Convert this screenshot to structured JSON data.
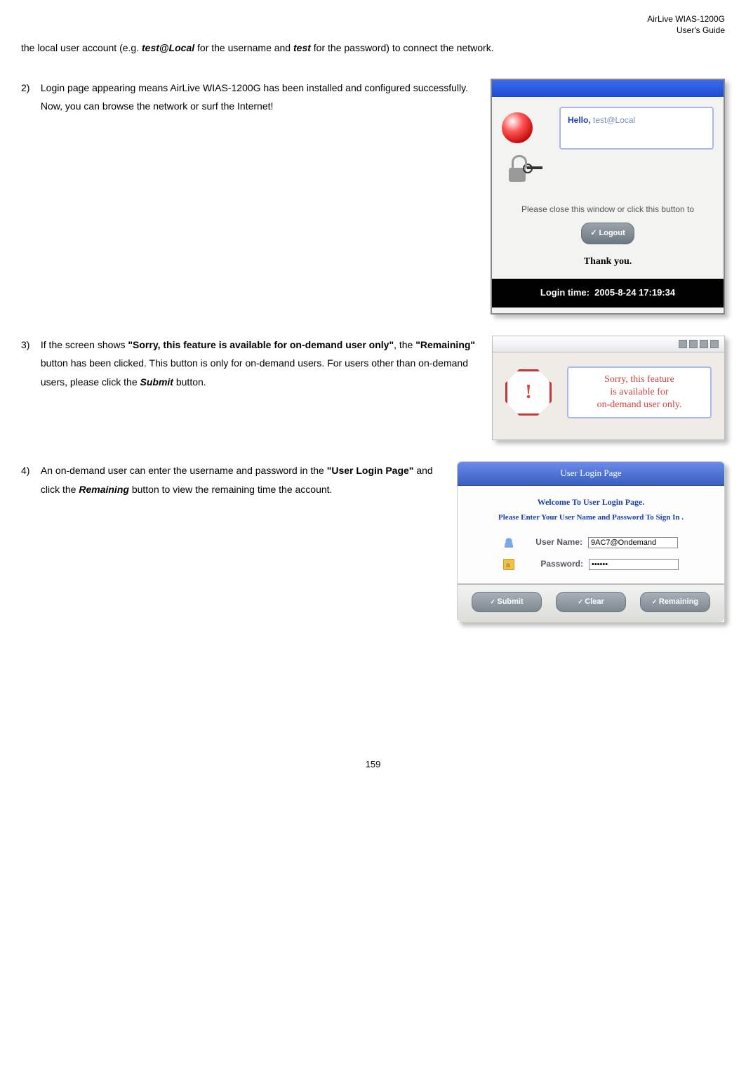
{
  "header": {
    "line1": "AirLive WIAS-1200G",
    "line2": "User's Guide"
  },
  "intro": {
    "pre": "the local user account (e.g. ",
    "b1": "test@Local",
    "mid": " for the username and ",
    "b2": "test",
    "post": " for the password) to connect the network."
  },
  "step2": {
    "num": "2)",
    "text": "Login page appearing means AirLive WIAS-1200G has been installed and configured successfully. Now, you can browse the network or surf the Internet!"
  },
  "step3": {
    "num": "3)",
    "t1": "If the screen shows ",
    "b1": "\"Sorry, this feature is available for on-demand user only\"",
    "t2": ", the ",
    "b2": "\"Remaining\"",
    "t3": " button has been clicked. This button is only for on-demand users. For users other than on-demand users, please click the ",
    "b3": "Submit",
    "t4": " button."
  },
  "step4": {
    "num": "4)",
    "t1": "An on-demand user can enter the username and password in the ",
    "b1": "\"User Login Page\"",
    "t2": " and click the ",
    "b2": "Remaining",
    "t3": " button to view the remaining time the account."
  },
  "fig1": {
    "hello": "Hello, ",
    "user": "test@Local",
    "msg": "Please close this window or click this button to",
    "logout": "Logout",
    "thank": "Thank you.",
    "login_time_label": "Login time:",
    "login_time_value": "2005-8-24 17:19:34"
  },
  "fig2": {
    "bang": "!",
    "l1": "Sorry, this feature",
    "l2": "is available for",
    "l3": "on-demand user only."
  },
  "fig3": {
    "title": "User Login Page",
    "welcome": "Welcome To User Login Page.",
    "sub": "Please Enter Your User Name and Password To Sign In .",
    "user_lbl": "User Name:",
    "user_val": "9AC7@Ondemand",
    "pw_lbl": "Password:",
    "pw_val": "••••••",
    "btn_submit": "Submit",
    "btn_clear": "Clear",
    "btn_remaining": "Remaining"
  },
  "page_number": "159"
}
